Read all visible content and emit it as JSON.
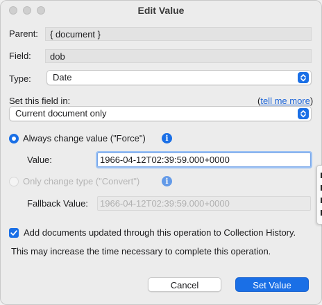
{
  "window": {
    "title": "Edit Value"
  },
  "parent": {
    "label": "Parent:",
    "value": "{ document }"
  },
  "field": {
    "label": "Field:",
    "value": "dob"
  },
  "type": {
    "label": "Type:",
    "selected": "Date"
  },
  "set_in": {
    "label": "Set this field in:",
    "help_open": "(",
    "help_link": "tell me more",
    "help_close": ")",
    "selected": "Current document only"
  },
  "force": {
    "label": "Always change value (\"Force\")",
    "selected": true
  },
  "value": {
    "label": "Value:",
    "text": "1966-04-12T02:39:59.000+0000"
  },
  "convert": {
    "label": "Only change type (\"Convert\")",
    "selected": false
  },
  "fallback": {
    "label": "Fallback Value:",
    "placeholder": "1966-04-12T02:39:59.000+0000"
  },
  "history": {
    "label": "Add documents updated through this operation to Collection History.",
    "checked": true
  },
  "note": "This may increase the time necessary to complete this operation.",
  "buttons": {
    "cancel": "Cancel",
    "set": "Set Value"
  },
  "icons": {
    "info": "i"
  },
  "colors": {
    "accent": "#1a6fe6",
    "link": "#1a63d8"
  }
}
